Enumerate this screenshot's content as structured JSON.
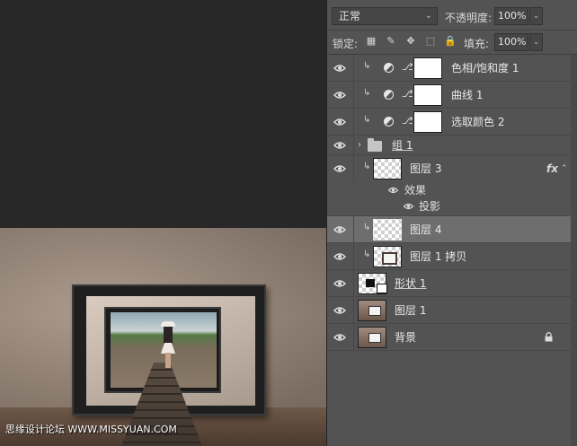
{
  "toolbar": {
    "blend_mode": "正常",
    "opacity_label": "不透明度:",
    "opacity_value": "100%",
    "lock_label": "锁定:",
    "fill_label": "填充:",
    "fill_value": "100%"
  },
  "layers": [
    {
      "name": "色相/饱和度 1",
      "kind": "adjustment"
    },
    {
      "name": "曲线 1",
      "kind": "adjustment"
    },
    {
      "name": "选取颜色 2",
      "kind": "adjustment"
    },
    {
      "name": "组 1",
      "kind": "group"
    },
    {
      "name": "图层 3",
      "kind": "pixel",
      "fx": "fx",
      "effects_label": "效果",
      "effects": [
        "投影"
      ]
    },
    {
      "name": "图层 4",
      "kind": "pixel",
      "selected": true
    },
    {
      "name": "图层 1 拷贝",
      "kind": "pixel"
    },
    {
      "name": "形状 1",
      "kind": "shape"
    },
    {
      "name": "图层 1",
      "kind": "pixel"
    },
    {
      "name": "背景",
      "kind": "background",
      "locked": true
    }
  ],
  "canvas": {
    "watermark": "思缘设计论坛 WWW.MISSYUAN.COM"
  },
  "colors": {
    "panel_bg": "#535353",
    "selected_row": "#6e6e6e",
    "canvas_bg": "#282828"
  }
}
